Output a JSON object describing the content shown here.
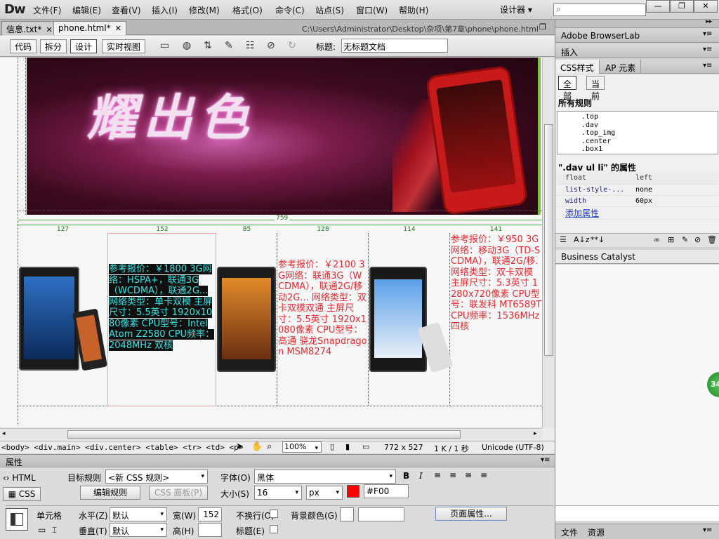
{
  "app": {
    "logo": "Dw",
    "menu": [
      "文件(F)",
      "编辑(E)",
      "查看(V)",
      "插入(I)",
      "修改(M)",
      "格式(O)",
      "命令(C)",
      "站点(S)",
      "窗口(W)",
      "帮助(H)"
    ],
    "workspace": "设计器 ▾",
    "window_buttons": [
      "—",
      "❐",
      "✕"
    ]
  },
  "tabs": {
    "items": [
      {
        "label": "信息.txt*"
      },
      {
        "label": "phone.html*"
      }
    ],
    "path": "C:\\Users\\Administrator\\Desktop\\杂项\\第7章\\phone\\phone.html"
  },
  "toolbar": {
    "views": [
      "代码",
      "拆分",
      "设计",
      "实时视图"
    ],
    "title_label": "标题:",
    "title_value": "无标题文档"
  },
  "page": {
    "banner_text": "耀出色",
    "total_width": "759",
    "col_widths": [
      "127",
      "152",
      "85",
      "128",
      "114",
      "141"
    ],
    "phones": [
      {
        "spec": "参考报价：￥1800 3G网络：HSPA+，联通3G（WCDMA），联通2G... 网络类型：单卡双模 主屏尺寸：5.5英寸 1920x1080像素 CPU型号：Intel Atom Z2580 CPU频率：2048MHz 双核"
      },
      {
        "spec": "参考报价：￥2100 3G网络：联通3G（WCDMA），联通2G/移动2G... 网络类型：双卡双模双通 主屏尺寸：5.5英寸 1920x1080像素 CPU型号：高通 骁龙Snapdragon MSM8274"
      },
      {
        "spec": "参考报价：￥950 3G网络：移动3G（TD-SCDMA），联通2G/移. 网络类型：双卡双模 主屏尺寸：5.3英寸 1280x720像素 CPU型号：联发科 MT6589T CPU频率：1536MHz 四核"
      }
    ]
  },
  "status": {
    "tag_path": "<body> <div.main> <div.center> <table> <tr> <td> <p>",
    "zoom": "100%",
    "size": "772 x 527",
    "download": "1 K / 1 秒",
    "encoding": "Unicode (UTF-8)"
  },
  "properties": {
    "title": "属性",
    "html_label": "HTML",
    "css_label": "CSS",
    "target_rule_label": "目标规则",
    "target_rule_value": "<新 CSS 规则>",
    "edit_rule": "编辑规则",
    "css_panel": "CSS 面板(P)",
    "font_label": "字体(O)",
    "font_value": "黑体",
    "size_label": "大小(S)",
    "size_value": "16",
    "unit_value": "px",
    "color_value": "#F00",
    "cell_label": "单元格",
    "horz_label": "水平(Z)",
    "horz_value": "默认",
    "vert_label": "垂直(T)",
    "vert_value": "默认",
    "width_label": "宽(W)",
    "width_value": "152",
    "height_label": "高(H)",
    "nowrap_label": "不换行(O)",
    "bg_label": "背景颜色(G)",
    "header_label": "标题(E)",
    "page_props": "页面属性..."
  },
  "panels": {
    "browserlab": "Adobe BrowserLab",
    "insert": "插入",
    "css_tab": "CSS样式",
    "ap_tab": "AP 元素",
    "all_btn": "全部",
    "current_btn": "当前",
    "all_rules": "所有规则",
    "rules": [
      ".top",
      ".dav",
      ".top_img",
      ".center",
      ".box1"
    ],
    "props_of": "\".dav ul li\" 的属性",
    "prop_rows": [
      {
        "name": "float",
        "value": "left"
      },
      {
        "name": "list-style-...",
        "value": "none"
      },
      {
        "name": "width",
        "value": "60px"
      }
    ],
    "add_prop": "添加属性",
    "business_catalyst": "Business Catalyst",
    "file_tab": "文件",
    "assets_tab": "资源",
    "badge": "34"
  },
  "colors": {
    "spec_text": "#e8282d",
    "selection_text": "#37e3e3",
    "guide_green": "#48a848",
    "text_color": "#F00"
  }
}
